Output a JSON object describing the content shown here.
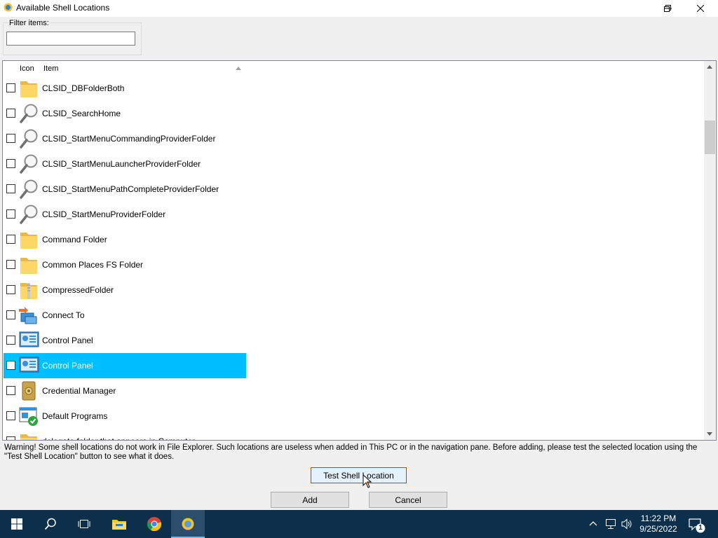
{
  "window": {
    "title": "Available Shell Locations",
    "minimize_icon": "minimize-icon",
    "restore_icon": "restore-icon",
    "close_icon": "close-icon"
  },
  "filter": {
    "label": "Filter items:",
    "value": ""
  },
  "list": {
    "columns": [
      "Icon",
      "Item"
    ],
    "sort_column": "Item",
    "sort_direction": "ascending",
    "rows": [
      {
        "label": "CLSID_DBFolderBoth",
        "icon": "folder-icon",
        "checked": false,
        "selected": false
      },
      {
        "label": "CLSID_SearchHome",
        "icon": "search-magnifier-icon",
        "checked": false,
        "selected": false
      },
      {
        "label": "CLSID_StartMenuCommandingProviderFolder",
        "icon": "search-magnifier-icon",
        "checked": false,
        "selected": false
      },
      {
        "label": "CLSID_StartMenuLauncherProviderFolder",
        "icon": "search-magnifier-icon",
        "checked": false,
        "selected": false
      },
      {
        "label": "CLSID_StartMenuPathCompleteProviderFolder",
        "icon": "search-magnifier-icon",
        "checked": false,
        "selected": false
      },
      {
        "label": "CLSID_StartMenuProviderFolder",
        "icon": "search-magnifier-icon",
        "checked": false,
        "selected": false
      },
      {
        "label": "Command Folder",
        "icon": "folder-icon",
        "checked": false,
        "selected": false
      },
      {
        "label": "Common Places FS Folder",
        "icon": "folder-icon",
        "checked": false,
        "selected": false
      },
      {
        "label": "CompressedFolder",
        "icon": "zip-folder-icon",
        "checked": false,
        "selected": false
      },
      {
        "label": "Connect To",
        "icon": "connect-to-icon",
        "checked": false,
        "selected": false
      },
      {
        "label": "Control Panel",
        "icon": "control-panel-icon",
        "checked": false,
        "selected": false
      },
      {
        "label": "Control Panel",
        "icon": "control-panel-icon",
        "checked": false,
        "selected": true
      },
      {
        "label": "Credential Manager",
        "icon": "credential-manager-icon",
        "checked": false,
        "selected": false
      },
      {
        "label": "Default Programs",
        "icon": "default-programs-icon",
        "checked": false,
        "selected": false
      },
      {
        "label": "delegate folder that appears in Computer",
        "icon": "folder-icon",
        "checked": false,
        "selected": false
      }
    ]
  },
  "warning_text": "Warning! Some shell locations do not work in File Explorer. Such locations are useless when added in This PC or in the navigation pane. Before adding, please test the selected location using the \"Test Shell Location\" button to see what it does.",
  "buttons": {
    "test": "Test Shell Location",
    "add": "Add",
    "cancel": "Cancel"
  },
  "taskbar": {
    "icons": [
      "windows-start-icon",
      "search-icon",
      "task-view-icon",
      "file-explorer-icon",
      "chrome-icon",
      "winaero-tweaker-icon"
    ],
    "time": "11:22 PM",
    "date": "9/25/2022",
    "notification_count": "1"
  },
  "colors": {
    "selection": "#00bfff",
    "taskbar": "#0c2f4c",
    "focus_border": "#0078d7"
  }
}
